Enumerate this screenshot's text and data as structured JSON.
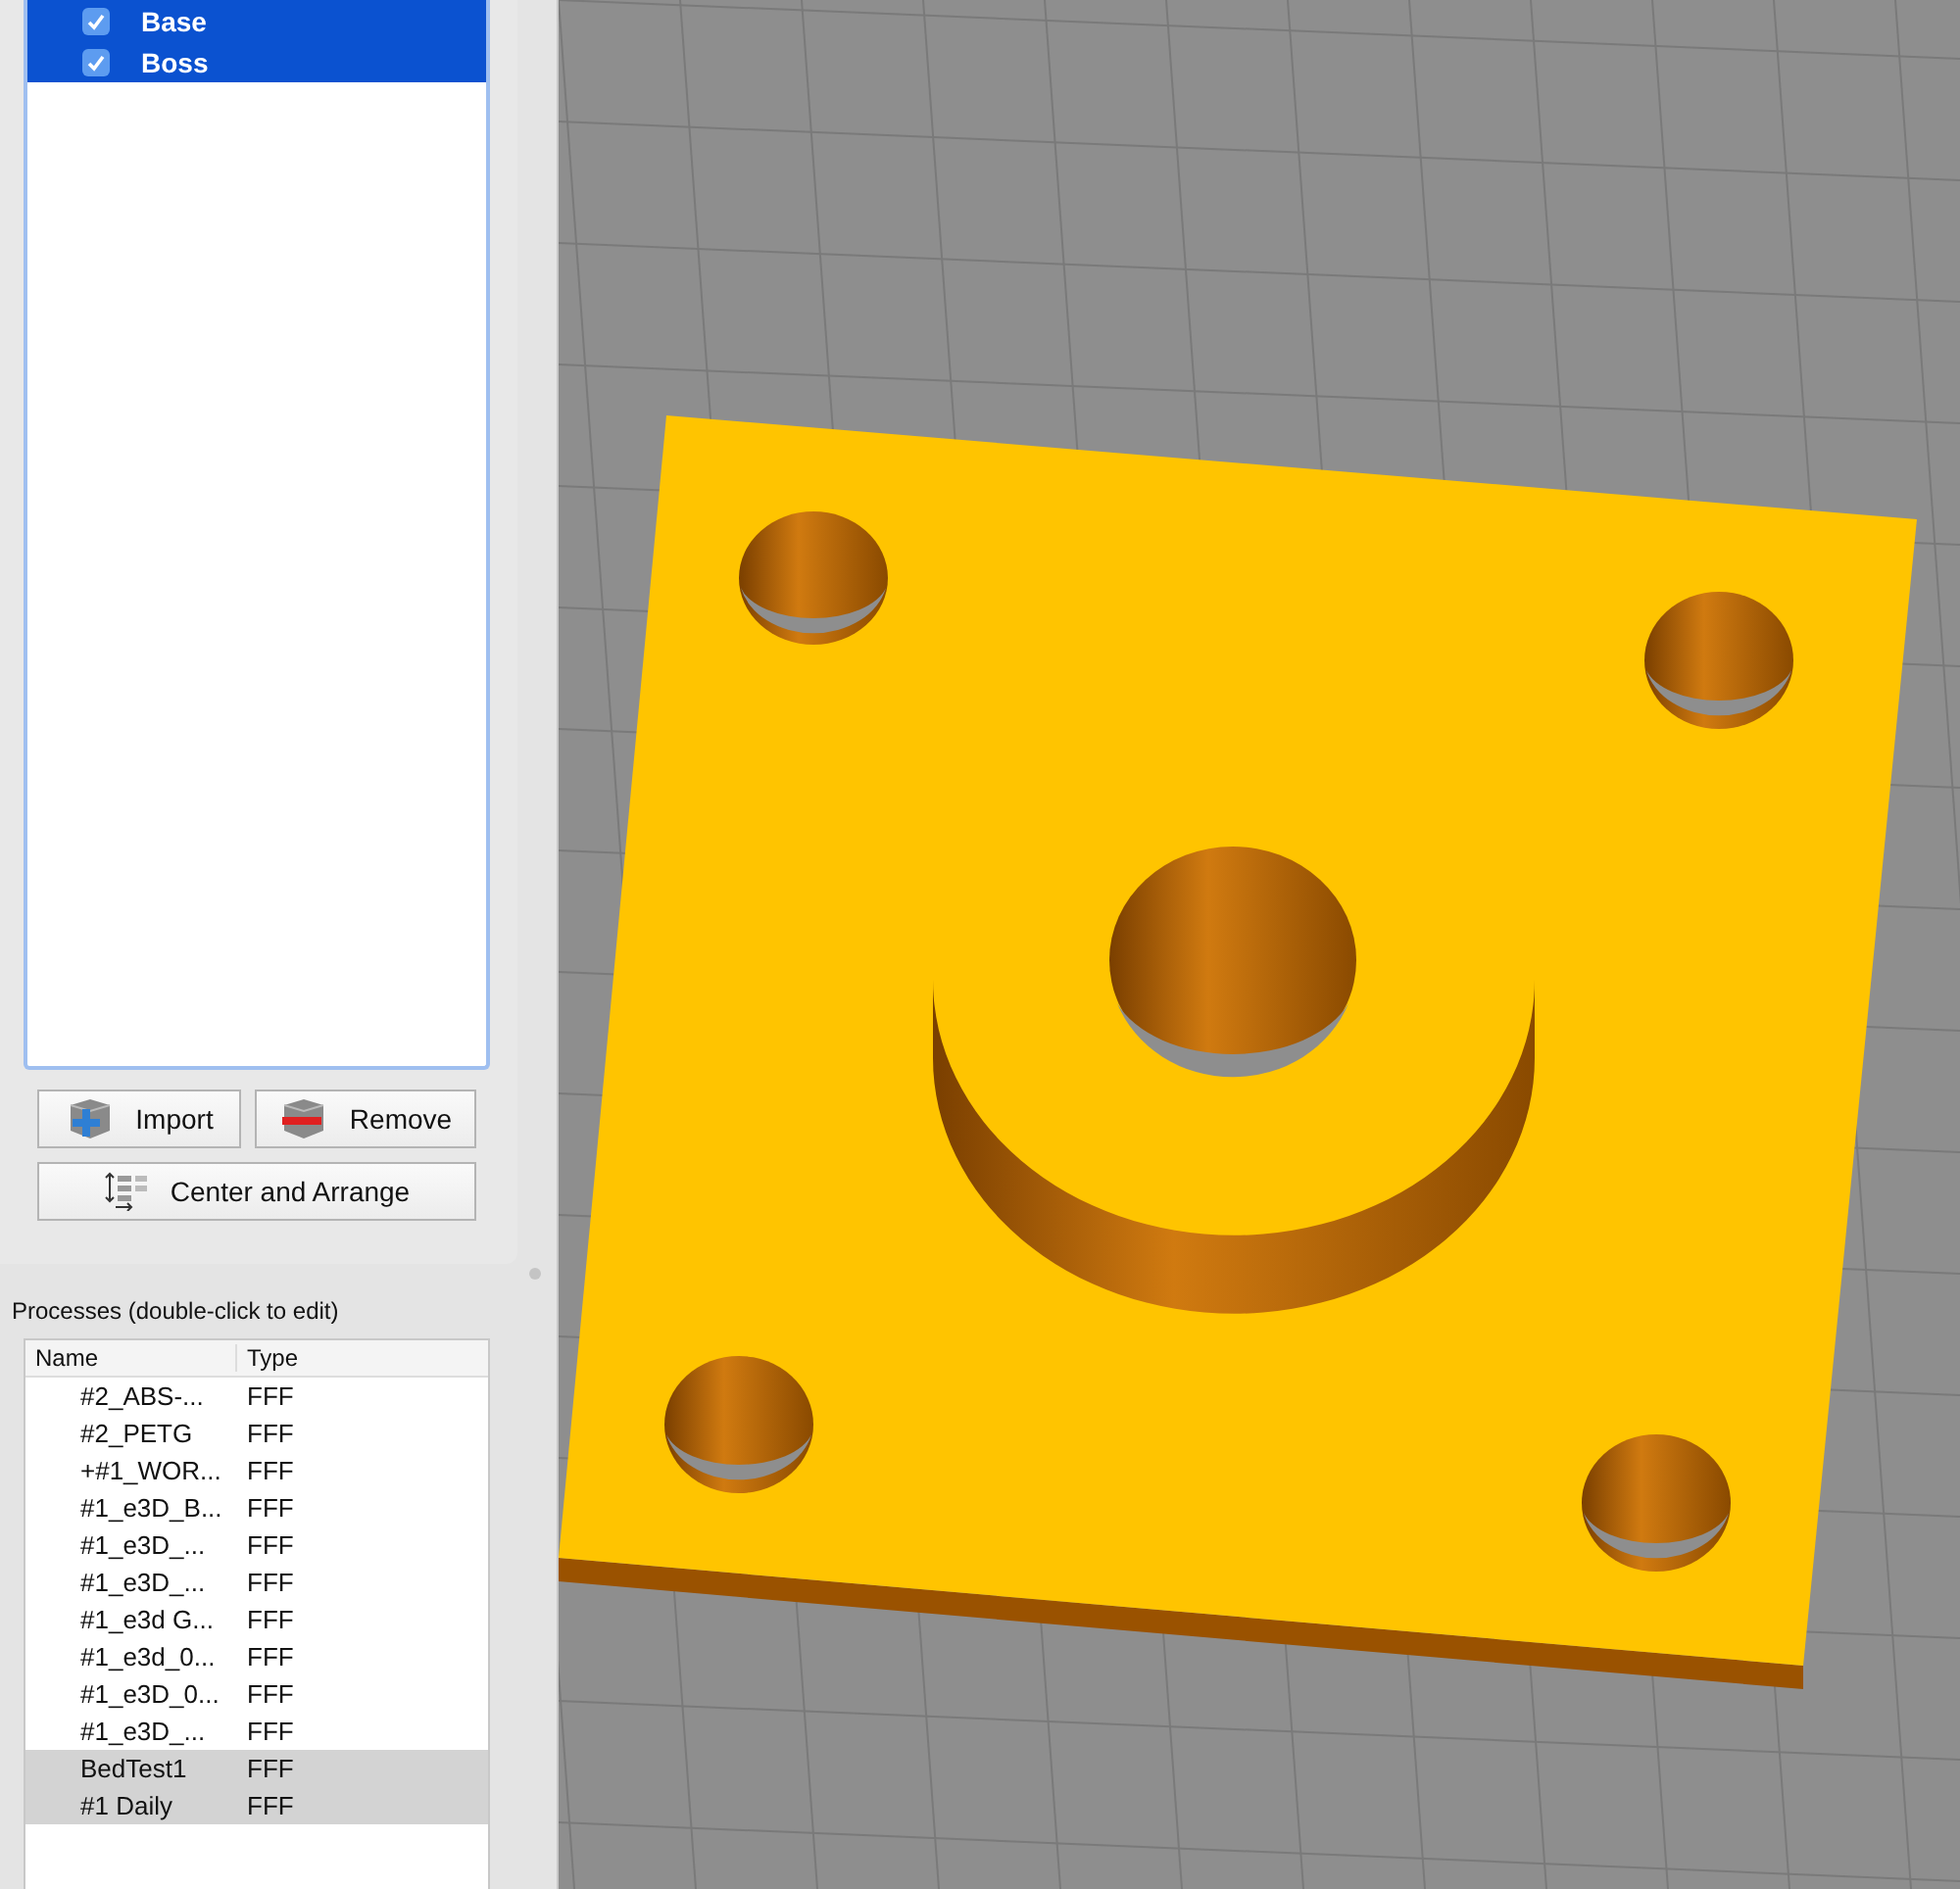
{
  "objects": [
    {
      "label": "Base",
      "checked": true,
      "selected": true
    },
    {
      "label": "Boss",
      "checked": true,
      "selected": true
    }
  ],
  "object_buttons": [
    {
      "label": "Import",
      "kind": "import"
    },
    {
      "label": "Remove",
      "kind": "remove"
    },
    {
      "label": "Center and Arrange",
      "kind": "arrange"
    }
  ],
  "processes": {
    "title": "Processes (double-click to edit)",
    "columns": [
      "Name",
      "Type"
    ],
    "rows": [
      {
        "name": "#2_ABS-...",
        "type": "FFF",
        "selected": false
      },
      {
        "name": "#2_PETG",
        "type": "FFF",
        "selected": false
      },
      {
        "name": "+#1_WOR...",
        "type": "FFF",
        "selected": false
      },
      {
        "name": "#1_e3D_B...",
        "type": "FFF",
        "selected": false
      },
      {
        "name": "#1_e3D_...",
        "type": "FFF",
        "selected": false
      },
      {
        "name": "#1_e3D_...",
        "type": "FFF",
        "selected": false
      },
      {
        "name": "#1_e3d G...",
        "type": "FFF",
        "selected": false
      },
      {
        "name": "#1_e3d_0...",
        "type": "FFF",
        "selected": false
      },
      {
        "name": "#1_e3D_0...",
        "type": "FFF",
        "selected": false
      },
      {
        "name": "#1_e3D_...",
        "type": "FFF",
        "selected": false
      },
      {
        "name": "BedTest1",
        "type": "FFF",
        "selected": true
      },
      {
        "name": "#1 Daily",
        "type": "FFF",
        "selected": true
      }
    ]
  }
}
